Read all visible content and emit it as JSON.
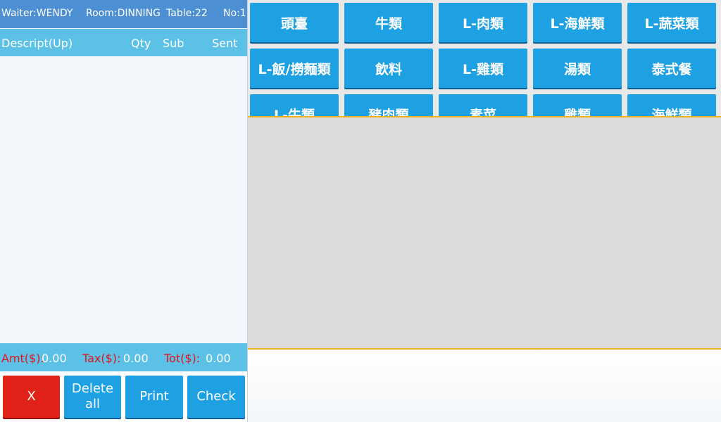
{
  "order": {
    "header": {
      "waiter": "Waiter:WENDY",
      "room": "Room:DINNING",
      "table": "Table:22",
      "no": "No:1"
    },
    "columns": {
      "descript": "Descript(Up)",
      "qty": "Qty",
      "sub": "Sub",
      "sent": "Sent"
    },
    "totals": {
      "amt_label": "Amt($):",
      "amt_value": "0.00",
      "tax_label": "Tax($):",
      "tax_value": "0.00",
      "tot_label": "Tot($):",
      "tot_value": "0.00"
    },
    "actions": {
      "x": "X",
      "delete_all": "Delete all",
      "print": "Print",
      "check": "Check"
    }
  },
  "categories": [
    "頭臺",
    "牛類",
    "L-肉類",
    "L-海鮮類",
    "L-蔬菜類",
    "L-飯/撈麵類",
    "飲料",
    "L-雞類",
    "湯類",
    "泰式餐",
    "L-牛類",
    "豬肉類",
    "素菜",
    "雞類",
    "海鮮類"
  ],
  "colors": {
    "header_blue": "#4d8fd3",
    "light_blue": "#5bc1e7",
    "button_blue": "#1ea1e3",
    "cancel_red": "#e02219",
    "total_label_red": "#e1131c",
    "divider_orange": "#f2b01e"
  }
}
